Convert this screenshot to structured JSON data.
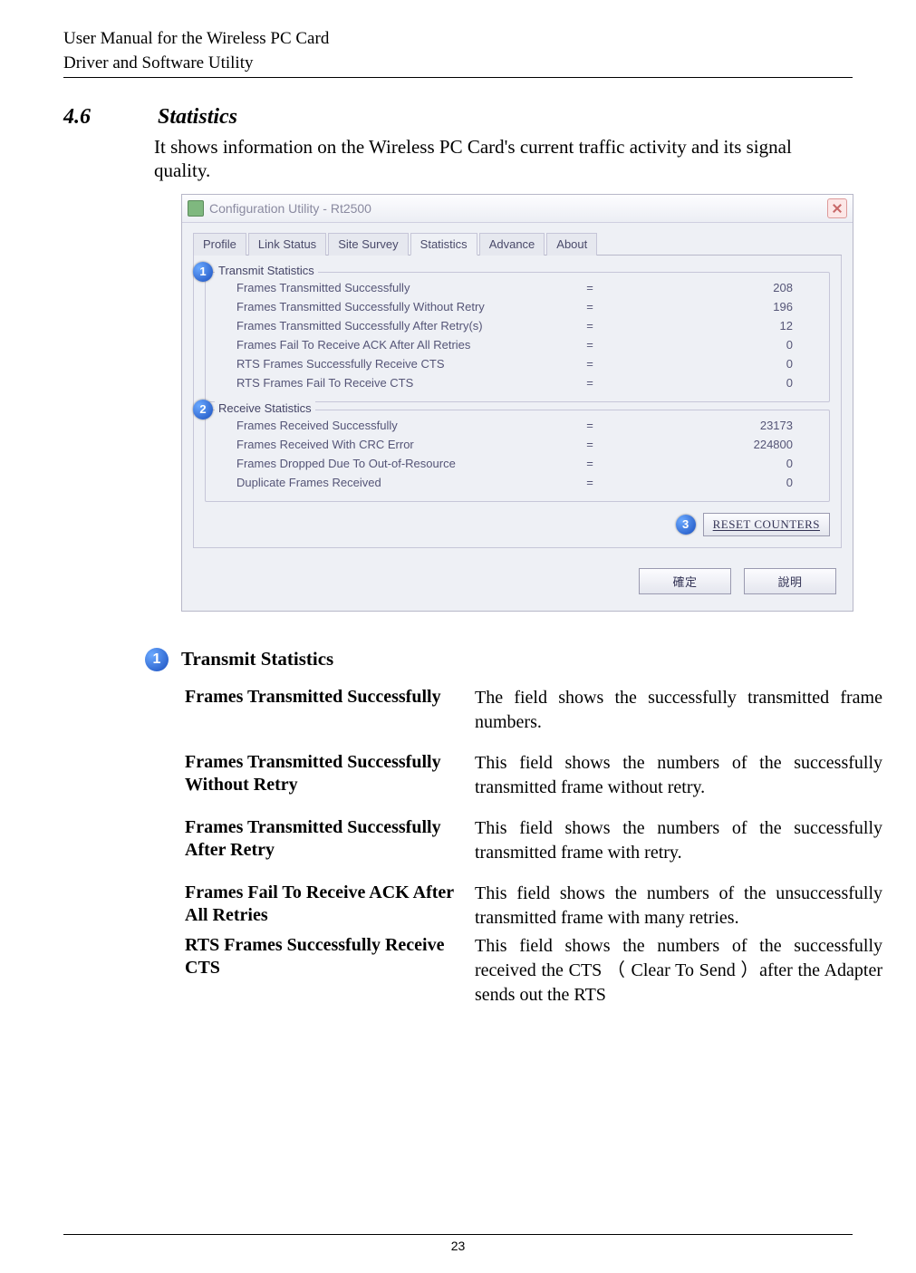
{
  "header": {
    "line1": "User Manual for the Wireless PC Card",
    "line2": "Driver and Software Utility"
  },
  "section": {
    "number": "4.6",
    "title": "Statistics",
    "intro": "It shows information on the Wireless PC Card's current traffic activity and its signal quality."
  },
  "app": {
    "window_title": "Configuration Utility - Rt2500",
    "tabs": [
      "Profile",
      "Link Status",
      "Site Survey",
      "Statistics",
      "Advance",
      "About"
    ],
    "active_tab_index": 3,
    "transmit": {
      "callout": "1",
      "title": "Transmit Statistics",
      "rows": [
        {
          "label": "Frames Transmitted Successfully",
          "value": "208"
        },
        {
          "label": "Frames Transmitted Successfully  Without Retry",
          "value": "196"
        },
        {
          "label": "Frames Transmitted Successfully After Retry(s)",
          "value": "12"
        },
        {
          "label": "Frames Fail To Receive ACK After All Retries",
          "value": "0"
        },
        {
          "label": "RTS Frames Successfully Receive CTS",
          "value": "0"
        },
        {
          "label": "RTS Frames Fail To Receive CTS",
          "value": "0"
        }
      ]
    },
    "receive": {
      "callout": "2",
      "title": "Receive Statistics",
      "rows": [
        {
          "label": "Frames Received Successfully",
          "value": "23173"
        },
        {
          "label": "Frames Received  With CRC Error",
          "value": "224800"
        },
        {
          "label": "Frames Dropped Due To Out-of-Resource",
          "value": "0"
        },
        {
          "label": "Duplicate Frames Received",
          "value": "0"
        }
      ]
    },
    "reset": {
      "callout": "3",
      "label": "RESET COUNTERS"
    },
    "footer_btns": [
      "確定",
      "說明"
    ]
  },
  "desc": {
    "callout": "1",
    "title": "Transmit Statistics",
    "items": [
      {
        "term": "Frames Transmitted Successfully",
        "def": "The field shows the successfully transmitted frame numbers."
      },
      {
        "term": "Frames Transmitted Successfully Without Retry",
        "def": "This field shows the numbers of the successfully transmitted frame without retry."
      },
      {
        "term": "Frames Transmitted Successfully After Retry",
        "def": "This field shows the numbers of the successfully transmitted frame with retry."
      },
      {
        "term": "Frames Fail To Receive ACK After All Retries",
        "def": "This field shows the numbers of the unsuccessfully transmitted frame with many retries."
      },
      {
        "term": "RTS Frames Successfully Receive CTS",
        "def": "This field shows the numbers of the successfully received the CTS （ Clear To Send ）after the Adapter sends out the RTS"
      }
    ]
  },
  "page_number": "23"
}
